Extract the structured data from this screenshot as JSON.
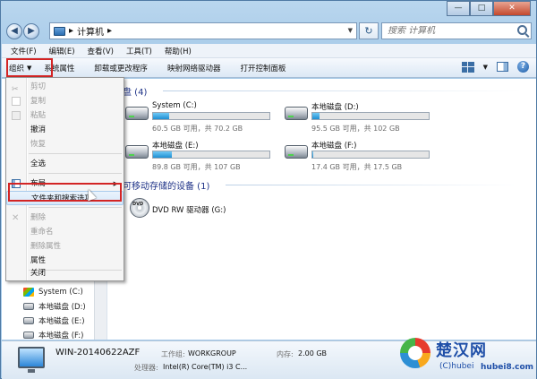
{
  "address": {
    "path": "计算机"
  },
  "search": {
    "placeholder": "搜索 计算机"
  },
  "window_controls": {
    "minimize": "—",
    "maximize": "□",
    "close": "✕"
  },
  "menubar": [
    "文件(F)",
    "编辑(E)",
    "查看(V)",
    "工具(T)",
    "帮助(H)"
  ],
  "toolbar": {
    "organize": "组织",
    "items": [
      "系统属性",
      "卸载或更改程序",
      "映射网络驱动器",
      "打开控制面板"
    ]
  },
  "groups": {
    "hard_disks": "硬盘 (4)",
    "removable": "有可移动存储的设备 (1)"
  },
  "drives": [
    {
      "name": "System (C:)",
      "info": "60.5 GB 可用，共 70.2 GB",
      "used_fraction": 0.14
    },
    {
      "name": "本地磁盘 (D:)",
      "info": "95.5 GB 可用，共 102 GB",
      "used_fraction": 0.06
    },
    {
      "name": "本地磁盘 (E:)",
      "info": "89.8 GB 可用，共 107 GB",
      "used_fraction": 0.16
    },
    {
      "name": "本地磁盘 (F:)",
      "info": "17.4 GB 可用，共 17.5 GB",
      "used_fraction": 0.01
    }
  ],
  "dvd": {
    "badge": "DVD",
    "name": "DVD RW 驱动器 (G:)"
  },
  "dropdown": {
    "cut": "剪切",
    "copy": "复制",
    "paste": "粘贴",
    "undo": "撤消",
    "redo": "恢复",
    "select_all": "全选",
    "layout": "布局",
    "folder_options": "文件夹和搜索选项",
    "delete": "删除",
    "rename": "重命名",
    "remove_properties": "删除属性",
    "properties": "属性",
    "close": "关闭"
  },
  "nav_pane": {
    "items": [
      "System (C:)",
      "本地磁盘 (D:)",
      "本地磁盘 (E:)",
      "本地磁盘 (F:)"
    ]
  },
  "details": {
    "computer_name": "WIN-20140622AZF",
    "workgroup_label": "工作组:",
    "workgroup": "WORKGROUP",
    "memory_label": "内存:",
    "memory": "2.00 GB",
    "processor_label": "处理器:",
    "processor": "Intel(R) Core(TM) i3 C..."
  },
  "watermark": {
    "brand": "楚汉网",
    "sub": "(C)hubei",
    "url": "hubei8.com"
  }
}
